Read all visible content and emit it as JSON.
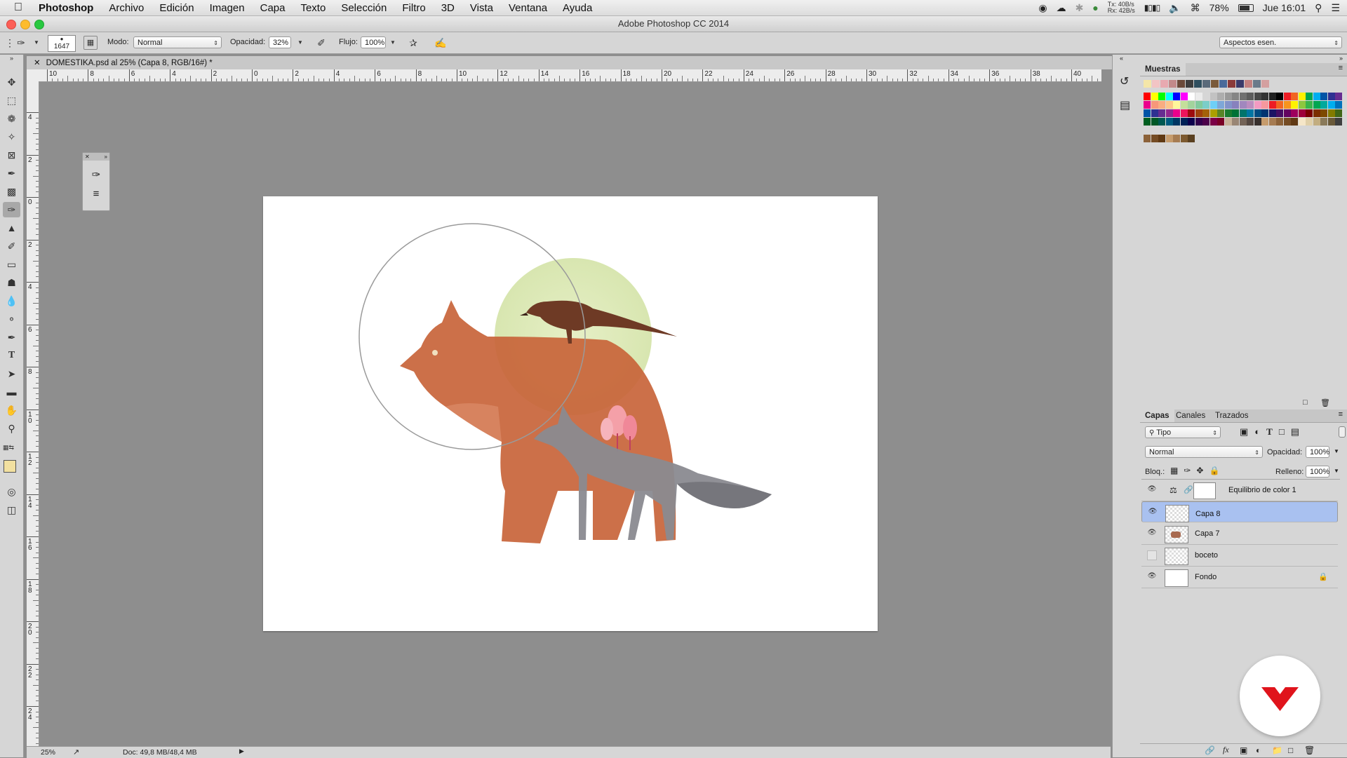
{
  "menubar": {
    "app_name": "Photoshop",
    "items": [
      "Archivo",
      "Edición",
      "Imagen",
      "Capa",
      "Texto",
      "Selección",
      "Filtro",
      "3D",
      "Vista",
      "Ventana",
      "Ayuda"
    ],
    "net_tx": "Tx: 40B/s",
    "net_rx": "Rx: 42B/s",
    "battery": "78%",
    "clock": "Jue 16:01"
  },
  "window": {
    "title": "Adobe Photoshop CC 2014"
  },
  "options": {
    "brush_size": "1647",
    "mode_label": "Modo:",
    "mode_value": "Normal",
    "opacity_label": "Opacidad:",
    "opacity_value": "32%",
    "flow_label": "Flujo:",
    "flow_value": "100%",
    "workspace": "Aspectos esen."
  },
  "document": {
    "tab_title": "DOMESTIKA.psd al 25% (Capa 8, RGB/16#) *",
    "zoom": "25%",
    "doc_info": "Doc: 49,8 MB/48,4 MB"
  },
  "ruler_h_labels": [
    "10",
    "8",
    "6",
    "4",
    "2",
    "0",
    "2",
    "4",
    "6",
    "8",
    "10",
    "12",
    "14",
    "16",
    "18",
    "20",
    "22",
    "24",
    "26",
    "28",
    "30",
    "32",
    "34",
    "36",
    "38",
    "40"
  ],
  "ruler_v_labels": [
    "4",
    "2",
    "0",
    "2",
    "4",
    "6",
    "8",
    "10",
    "12",
    "14",
    "16",
    "18",
    "20",
    "22",
    "24",
    "2"
  ],
  "swatches_panel": {
    "title": "Muestras",
    "recent": [
      "#f4e6a8",
      "#f2c4c4",
      "#e8a9b0",
      "#c28a8a",
      "#6b4a3a",
      "#3e3e3e",
      "#2f4f5f",
      "#5a6a7a",
      "#7a5a3a",
      "#4a6a9a",
      "#8a3a3a",
      "#3a3a6a",
      "#c28080",
      "#6a7a8a",
      "#d4a0a0"
    ],
    "grid": [
      [
        "#ff0000",
        "#ffff00",
        "#00ff00",
        "#00ffff",
        "#0000ff",
        "#ff00ff",
        "#ffffff",
        "#ebebeb",
        "#d6d6d6",
        "#c2c2c2",
        "#adadad",
        "#999999",
        "#858585",
        "#707070",
        "#5c5c5c",
        "#474747",
        "#333333",
        "#1f1f1f",
        "#000000",
        "#ed1c24",
        "#f26522",
        "#fff200",
        "#00a651",
        "#00aeef",
        "#0054a6",
        "#2e3192",
        "#662d91"
      ],
      [
        "#ec008c",
        "#f7977a",
        "#f9ad81",
        "#fdc68a",
        "#fff79a",
        "#c4df9b",
        "#a2d39c",
        "#82ca9d",
        "#7bcdc8",
        "#6ecff6",
        "#7ea7d8",
        "#8393ca",
        "#8781bd",
        "#a187be",
        "#bc8dbf",
        "#f49ac2",
        "#f6989d",
        "#ed1c24",
        "#f26522",
        "#f7941d",
        "#fff200",
        "#8dc73f",
        "#39b54a",
        "#00a651",
        "#00a99d",
        "#00aeef",
        "#0072bc"
      ],
      [
        "#0054a6",
        "#2e3192",
        "#662d91",
        "#92278f",
        "#ec008c",
        "#ed145b",
        "#9e0b0f",
        "#a0410d",
        "#a3620a",
        "#aba000",
        "#598527",
        "#1a7b30",
        "#007236",
        "#00746b",
        "#0076a3",
        "#004b80",
        "#003471",
        "#1b1464",
        "#440e62",
        "#630460",
        "#9e005d",
        "#9e0039",
        "#790000",
        "#7b2e00",
        "#7d4900",
        "#827b00",
        "#406618"
      ],
      [
        "#005e20",
        "#005826",
        "#005952",
        "#005b7f",
        "#003663",
        "#002157",
        "#0d004c",
        "#32004b",
        "#4b0049",
        "#7b0046",
        "#7a0026",
        "#c7b299",
        "#998675",
        "#736357",
        "#534741",
        "#37302d",
        "#c69c6d",
        "#a67c52",
        "#8c6239",
        "#754c24",
        "#603913",
        "#f5e6c8",
        "#e0cfa8",
        "#c2ad80",
        "#8a7a5a",
        "#6a5a3a",
        "#3f3f3f"
      ]
    ]
  },
  "layers_panel": {
    "tabs": [
      "Capas",
      "Canales",
      "Trazados"
    ],
    "filter_kind": "Tipo",
    "blend_mode": "Normal",
    "opacity_label": "Opacidad:",
    "opacity_value": "100%",
    "lock_label": "Bloq.:",
    "fill_label": "Relleno:",
    "fill_value": "100%",
    "layers": [
      {
        "name": "Equilibrio de color 1",
        "visible": true,
        "selected": false,
        "type": "adjustment"
      },
      {
        "name": "Capa 8",
        "visible": true,
        "selected": true,
        "type": "pixel"
      },
      {
        "name": "Capa 7",
        "visible": true,
        "selected": false,
        "type": "pixel"
      },
      {
        "name": "boceto",
        "visible": false,
        "selected": false,
        "type": "pixel"
      },
      {
        "name": "Fondo",
        "visible": true,
        "selected": false,
        "type": "background",
        "locked": true
      }
    ]
  },
  "colors": {
    "foreground": "#f2e0a0",
    "background": "#5a3a2a",
    "bear": "#c8643a",
    "wolf": "#8a8a90",
    "sun": "#dbe8b4",
    "bird": "#6e3a25",
    "tree": "#f4a0a8",
    "brand_red": "#e0141c",
    "layer_selected": "#a9c1f0"
  }
}
